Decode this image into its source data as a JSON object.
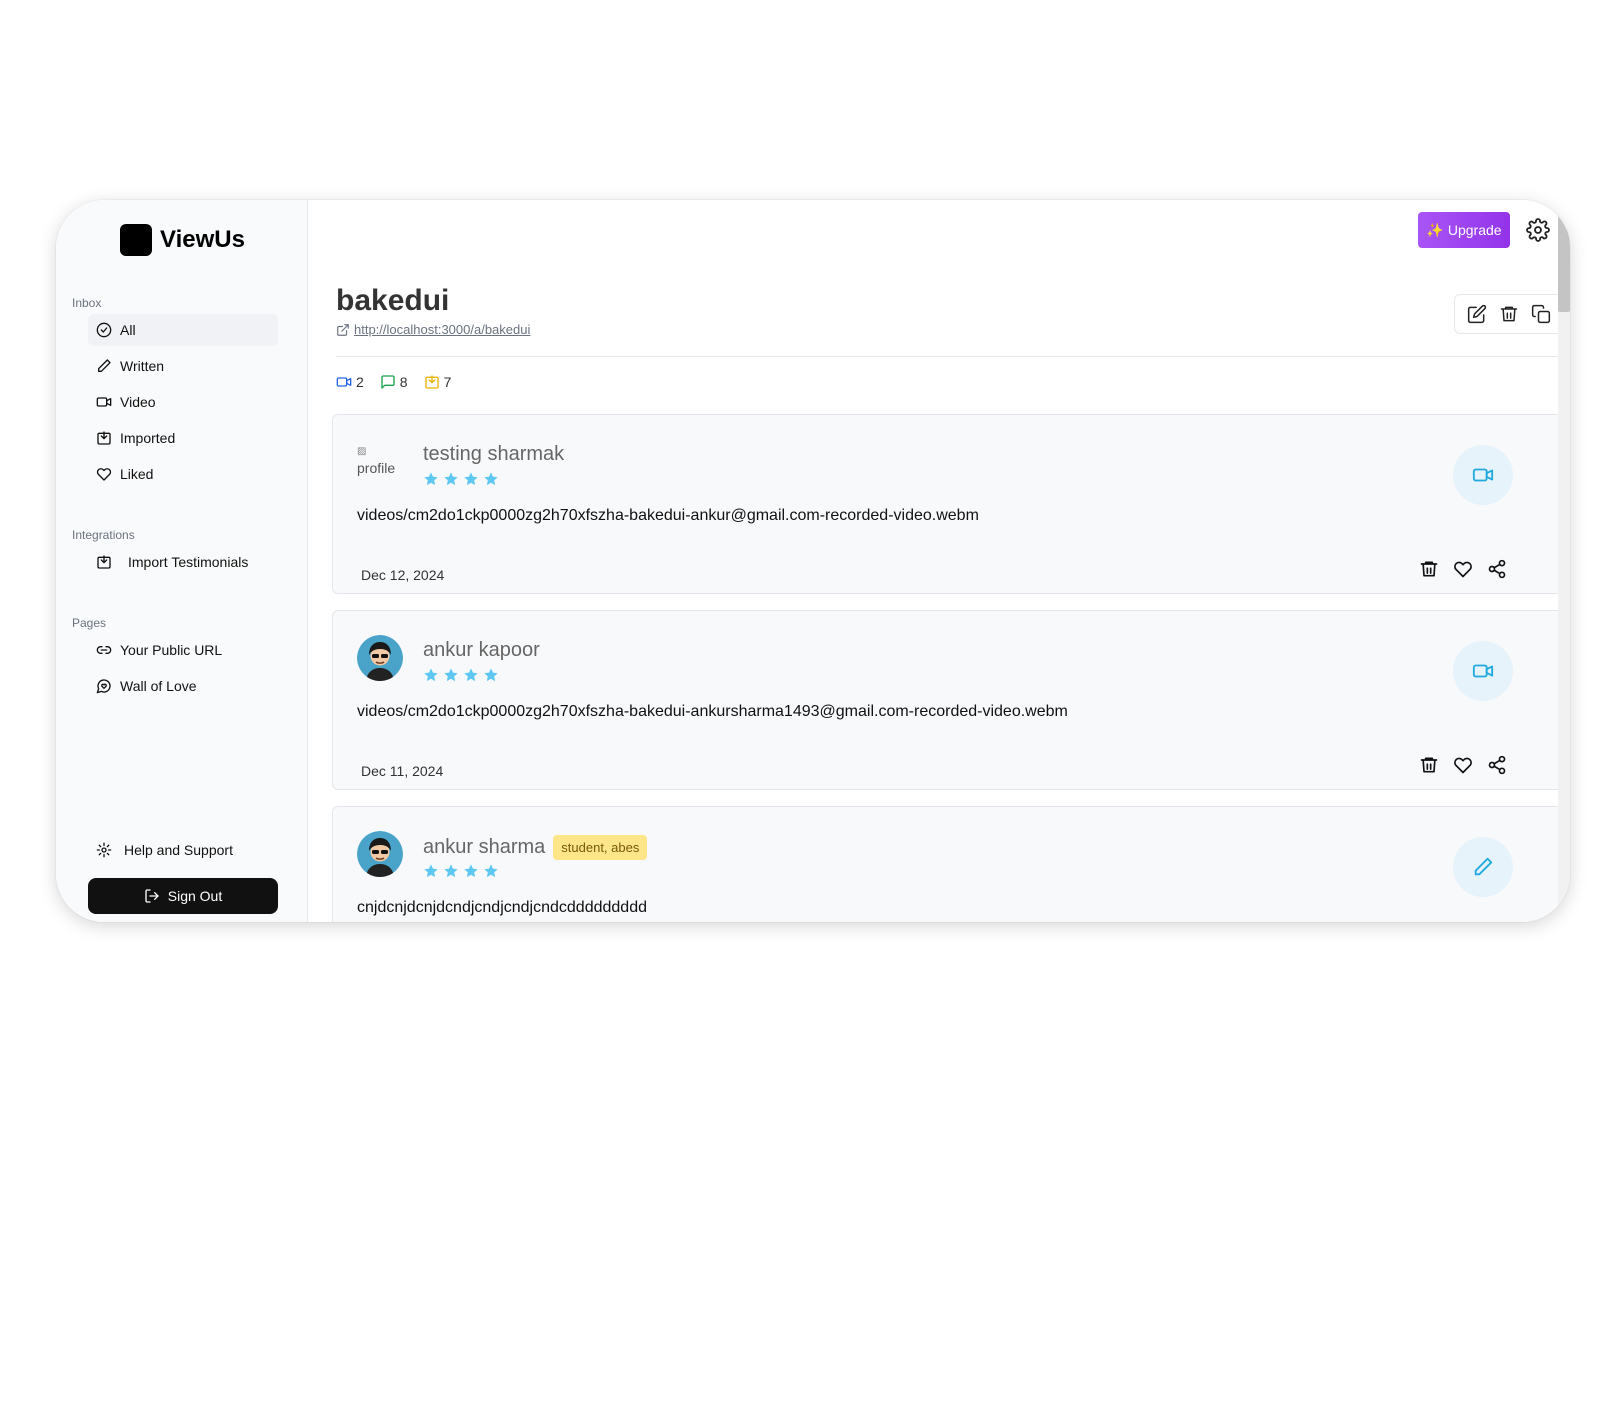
{
  "app": {
    "name": "ViewUs"
  },
  "sidebar": {
    "inbox_label": "Inbox",
    "inbox_items": [
      {
        "label": "All",
        "icon": "check-circle-icon",
        "active": true
      },
      {
        "label": "Written",
        "icon": "pencil-icon"
      },
      {
        "label": "Video",
        "icon": "video-icon"
      },
      {
        "label": "Imported",
        "icon": "import-icon"
      },
      {
        "label": "Liked",
        "icon": "heart-icon"
      }
    ],
    "integrations_label": "Integrations",
    "integrations_items": [
      {
        "label": "Import Testimonials",
        "icon": "import-icon"
      }
    ],
    "pages_label": "Pages",
    "pages_items": [
      {
        "label": "Your Public URL",
        "icon": "link-icon"
      },
      {
        "label": "Wall of Love",
        "icon": "message-heart-icon"
      }
    ],
    "help_label": "Help and Support",
    "signout_label": "Sign Out"
  },
  "topbar": {
    "upgrade_label": "Upgrade",
    "upgrade_icon": "sparkles"
  },
  "project": {
    "title": "bakedui",
    "url": "http://localhost:3000/a/bakedui",
    "counts": {
      "video": "2",
      "written": "8",
      "imported": "7"
    }
  },
  "testimonials": [
    {
      "name": "testing sharmak",
      "avatar_alt": "profile",
      "rating": 4,
      "type": "video",
      "content": "videos/cm2do1ckp0000zg2h70xfszha-bakedui-ankur@gmail.com-recorded-video.webm",
      "date": "Dec 12, 2024"
    },
    {
      "name": "ankur kapoor",
      "rating": 4,
      "type": "video",
      "content": "videos/cm2do1ckp0000zg2h70xfszha-bakedui-ankursharma1493@gmail.com-recorded-video.webm",
      "date": "Dec 11, 2024"
    },
    {
      "name": "ankur sharma",
      "badge": "student, abes",
      "rating": 4,
      "type": "written",
      "content": "cnjdcnjdcnjdcndjcndjcndjcndcddddddddd"
    }
  ],
  "colors": {
    "accent_purple": "#9333ea",
    "star": "#5ec8f2",
    "type_icon": "#21a9e0",
    "count_video": "#2563eb",
    "count_written": "#16a34a",
    "count_imported": "#eab308",
    "badge_bg": "#fde68a"
  }
}
